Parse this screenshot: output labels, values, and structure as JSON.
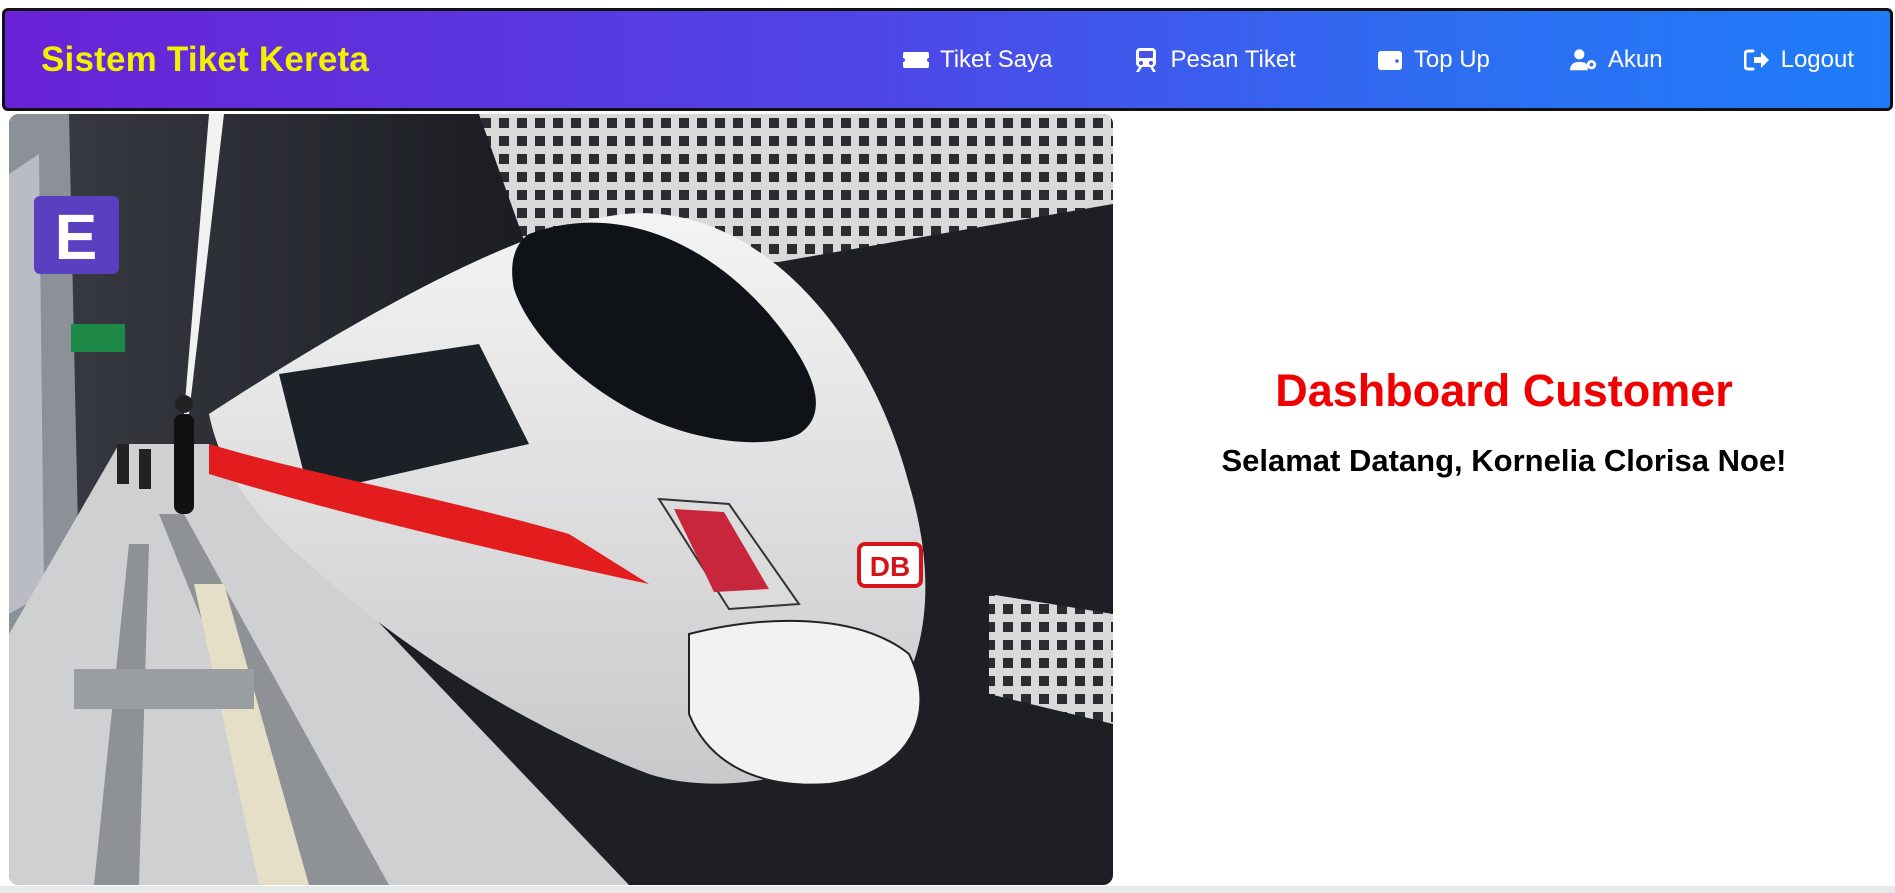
{
  "navbar": {
    "brand": "Sistem Tiket Kereta",
    "items": [
      {
        "label": "Tiket Saya",
        "icon": "ticket-icon"
      },
      {
        "label": "Pesan Tiket",
        "icon": "train-icon"
      },
      {
        "label": "Top Up",
        "icon": "wallet-icon"
      },
      {
        "label": "Akun",
        "icon": "user-gear-icon"
      },
      {
        "label": "Logout",
        "icon": "logout-icon"
      }
    ],
    "gradient": [
      "#6a22d6",
      "#1f7cf9"
    ],
    "brand_color": "#f3f000"
  },
  "hero": {
    "image": "high-speed-train-at-station-photo",
    "platform_sign": "E",
    "logo_text": "DB"
  },
  "main": {
    "title": "Dashboard Customer",
    "greeting": "Selamat Datang, Kornelia Clorisa Noe!",
    "title_color": "#f00000"
  }
}
